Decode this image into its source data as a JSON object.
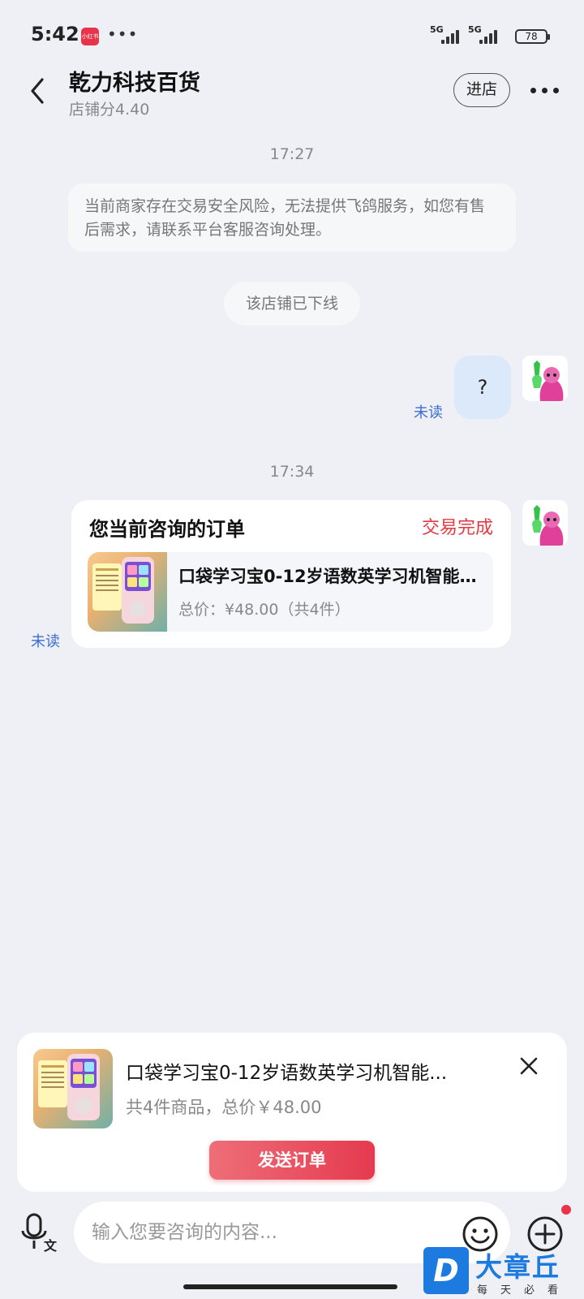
{
  "status_bar": {
    "time": "5:42",
    "app_badge": "小红书",
    "more": "•••",
    "net1": "5G",
    "net2": "5G",
    "battery": "78"
  },
  "header": {
    "title": "乾力科技百货",
    "score": "店铺分4.40",
    "enter_label": "进店"
  },
  "chat": {
    "time1": "17:27",
    "system_notice": "当前商家存在交易安全风险，无法提供飞鸽服务，如您有售后需求，请联系平台客服咨询处理。",
    "offline_notice": "该店铺已下线",
    "user_message": "?",
    "unread_label": "未读",
    "time2": "17:34",
    "order_card": {
      "title": "您当前咨询的订单",
      "status": "交易完成",
      "product_name": "口袋学习宝0-12岁语数英学习机智能...",
      "price": "总价：¥48.00（共4件）"
    },
    "unread_label2": "未读"
  },
  "send_panel": {
    "product_name": "口袋学习宝0-12岁语数英学习机智能...",
    "summary": "共4件商品，总价￥48.00",
    "send_label": "发送订单"
  },
  "input": {
    "placeholder": "输入您要咨询的内容..."
  },
  "watermark": {
    "logo_letter": "D",
    "title": "大章丘",
    "subtitle": "每天必看"
  },
  "colors": {
    "accent_red": "#e53a44",
    "bubble_blue": "#dbe9fb",
    "unread_blue": "#3a6fd0"
  }
}
